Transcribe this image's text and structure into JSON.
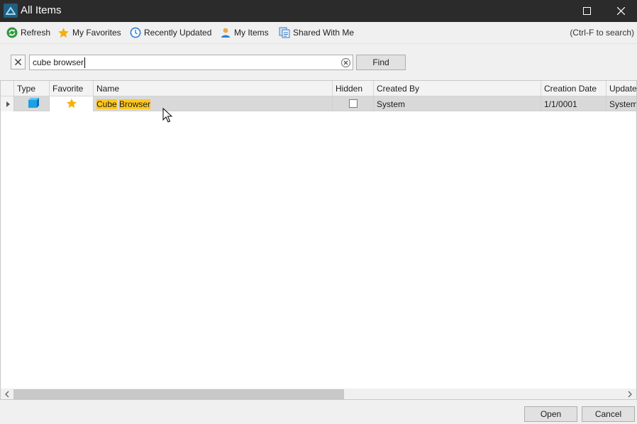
{
  "window": {
    "title": "All Items"
  },
  "toolbar": {
    "items": [
      {
        "label": "Refresh",
        "icon": "refresh-icon"
      },
      {
        "label": "My Favorites",
        "icon": "star-icon"
      },
      {
        "label": "Recently Updated",
        "icon": "clock-icon"
      },
      {
        "label": "My Items",
        "icon": "user-icon"
      },
      {
        "label": "Shared With Me",
        "icon": "shared-icon"
      }
    ],
    "hint": "(Ctrl-F to search)"
  },
  "search": {
    "value": "cube browser",
    "find_label": "Find"
  },
  "grid": {
    "columns": [
      "Type",
      "Favorite",
      "Name",
      "Hidden",
      "Created By",
      "Creation Date",
      "Update"
    ],
    "rows": [
      {
        "type_icon": "cube-icon",
        "favorite": true,
        "name_part1": "Cube",
        "name_part2": "Browser",
        "hidden": false,
        "created_by": "System",
        "creation_date": "1/1/0001",
        "updated_by": "System"
      }
    ]
  },
  "footer": {
    "open_label": "Open",
    "cancel_label": "Cancel"
  },
  "colors": {
    "titlebar": "#2b2b2b",
    "highlight": "#ffc81f",
    "selected_row": "#d9d9d9",
    "accent": "#1f5f83"
  }
}
